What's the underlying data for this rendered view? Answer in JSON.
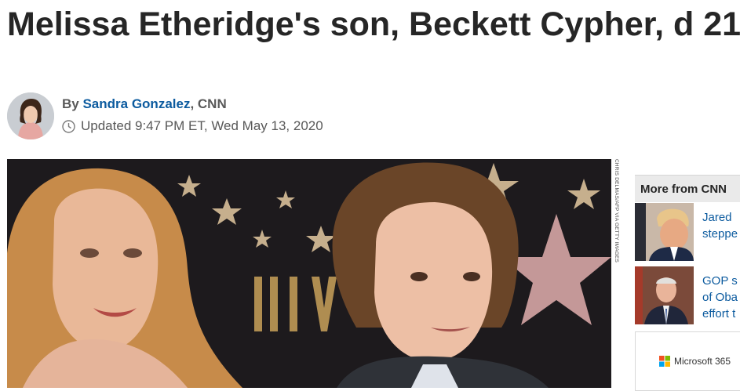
{
  "article": {
    "headline": "Melissa Etheridge's son, Beckett Cypher, d 21",
    "byline_prefix": "By",
    "author": "Sandra Gonzalez",
    "outlet": ", CNN",
    "updated": "Updated 9:47 PM ET, Wed May 13, 2020",
    "photo_credit": "CHRIS DELMAS/AFP VIA GETTY IMAGES"
  },
  "sidebar": {
    "header": "More from CNN",
    "items": [
      {
        "text_line1": "Jared",
        "text_line2": "steppe"
      },
      {
        "text_line1": "GOP s",
        "text_line2": "of Oba",
        "text_line3": "effort t"
      }
    ],
    "ad": {
      "label": "Microsoft 365"
    }
  },
  "colors": {
    "link": "#0c5b9f",
    "headline": "#262626",
    "meta": "#595959"
  }
}
